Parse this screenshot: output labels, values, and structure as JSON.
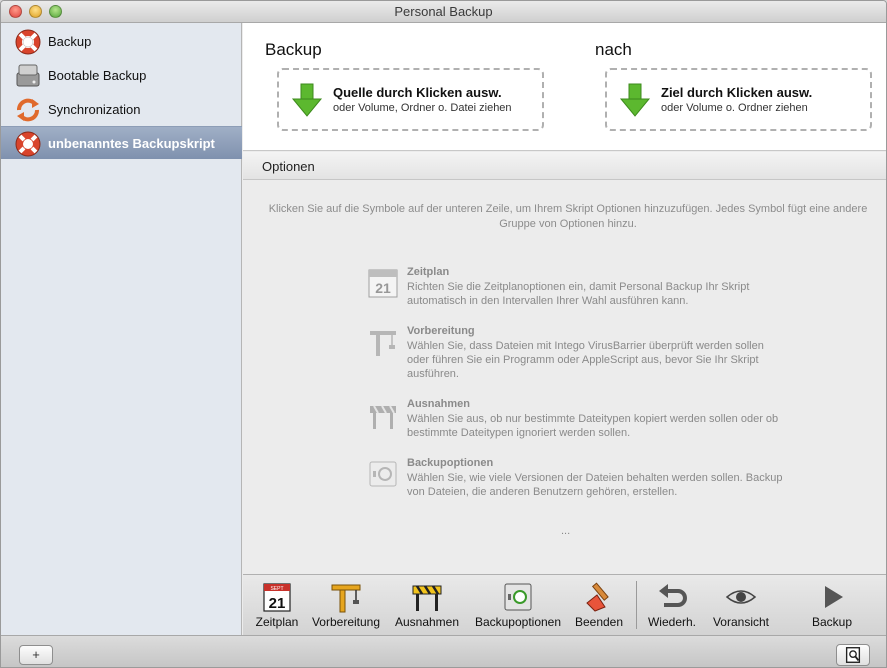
{
  "window": {
    "title": "Personal Backup"
  },
  "sidebar": {
    "items": [
      {
        "label": "Backup",
        "icon": "lifebuoy-icon"
      },
      {
        "label": "Bootable Backup",
        "icon": "harddisk-icon"
      },
      {
        "label": "Synchronization",
        "icon": "sync-arrows-icon"
      },
      {
        "label": "unbenanntes Backupskript",
        "icon": "lifebuoy-icon",
        "selected": true
      }
    ]
  },
  "source": {
    "heading": "Backup",
    "main": "Quelle durch Klicken ausw.",
    "sub": "oder Volume, Ordner o. Datei ziehen"
  },
  "target": {
    "heading": "nach",
    "main": "Ziel durch Klicken ausw.",
    "sub": "oder Volume o. Ordner ziehen"
  },
  "options": {
    "header": "Optionen",
    "intro": "Klicken Sie auf die Symbole auf der unteren Zeile, um Ihrem Skript Optionen hinzuzufügen. Jedes Symbol fügt eine andere Gruppe von Optionen hinzu.",
    "items": [
      {
        "title": "Zeitplan",
        "text": "Richten Sie die Zeitplanoptionen ein, damit Personal Backup Ihr Skript automatisch in den Intervallen Ihrer Wahl ausführen kann.",
        "icon": "calendar-icon"
      },
      {
        "title": "Vorbereitung",
        "text": "Wählen Sie, dass Dateien mit Intego VirusBarrier überprüft werden sollen oder führen Sie ein Programm oder AppleScript aus, bevor Sie Ihr Skript ausführen.",
        "icon": "crane-icon"
      },
      {
        "title": "Ausnahmen",
        "text": "Wählen Sie aus, ob nur bestimmte Dateitypen kopiert werden sollen oder ob bestimmte Dateitypen ignoriert werden sollen.",
        "icon": "barrier-icon"
      },
      {
        "title": "Backupoptionen",
        "text": "Wählen Sie, wie viele Versionen der Dateien behalten werden sollen. Backup von Dateien, die anderen Benutzern gehören, erstellen.",
        "icon": "safe-icon"
      }
    ],
    "ellipsis": "..."
  },
  "toolbar": {
    "zeitplan": "Zeitplan",
    "vorbereitung": "Vorbereitung",
    "ausnahmen": "Ausnahmen",
    "backupoptionen": "Backupoptionen",
    "beenden": "Beenden",
    "wiederh": "Wiederh.",
    "voransicht": "Voransicht",
    "backup": "Backup"
  },
  "bottom": {
    "add": "+"
  },
  "calendar": {
    "month": "SEPT",
    "day": "21"
  },
  "colors": {
    "selection": "#8799b5",
    "arrow_green": "#5cb82f",
    "lifebuoy_red": "#d9442c"
  }
}
